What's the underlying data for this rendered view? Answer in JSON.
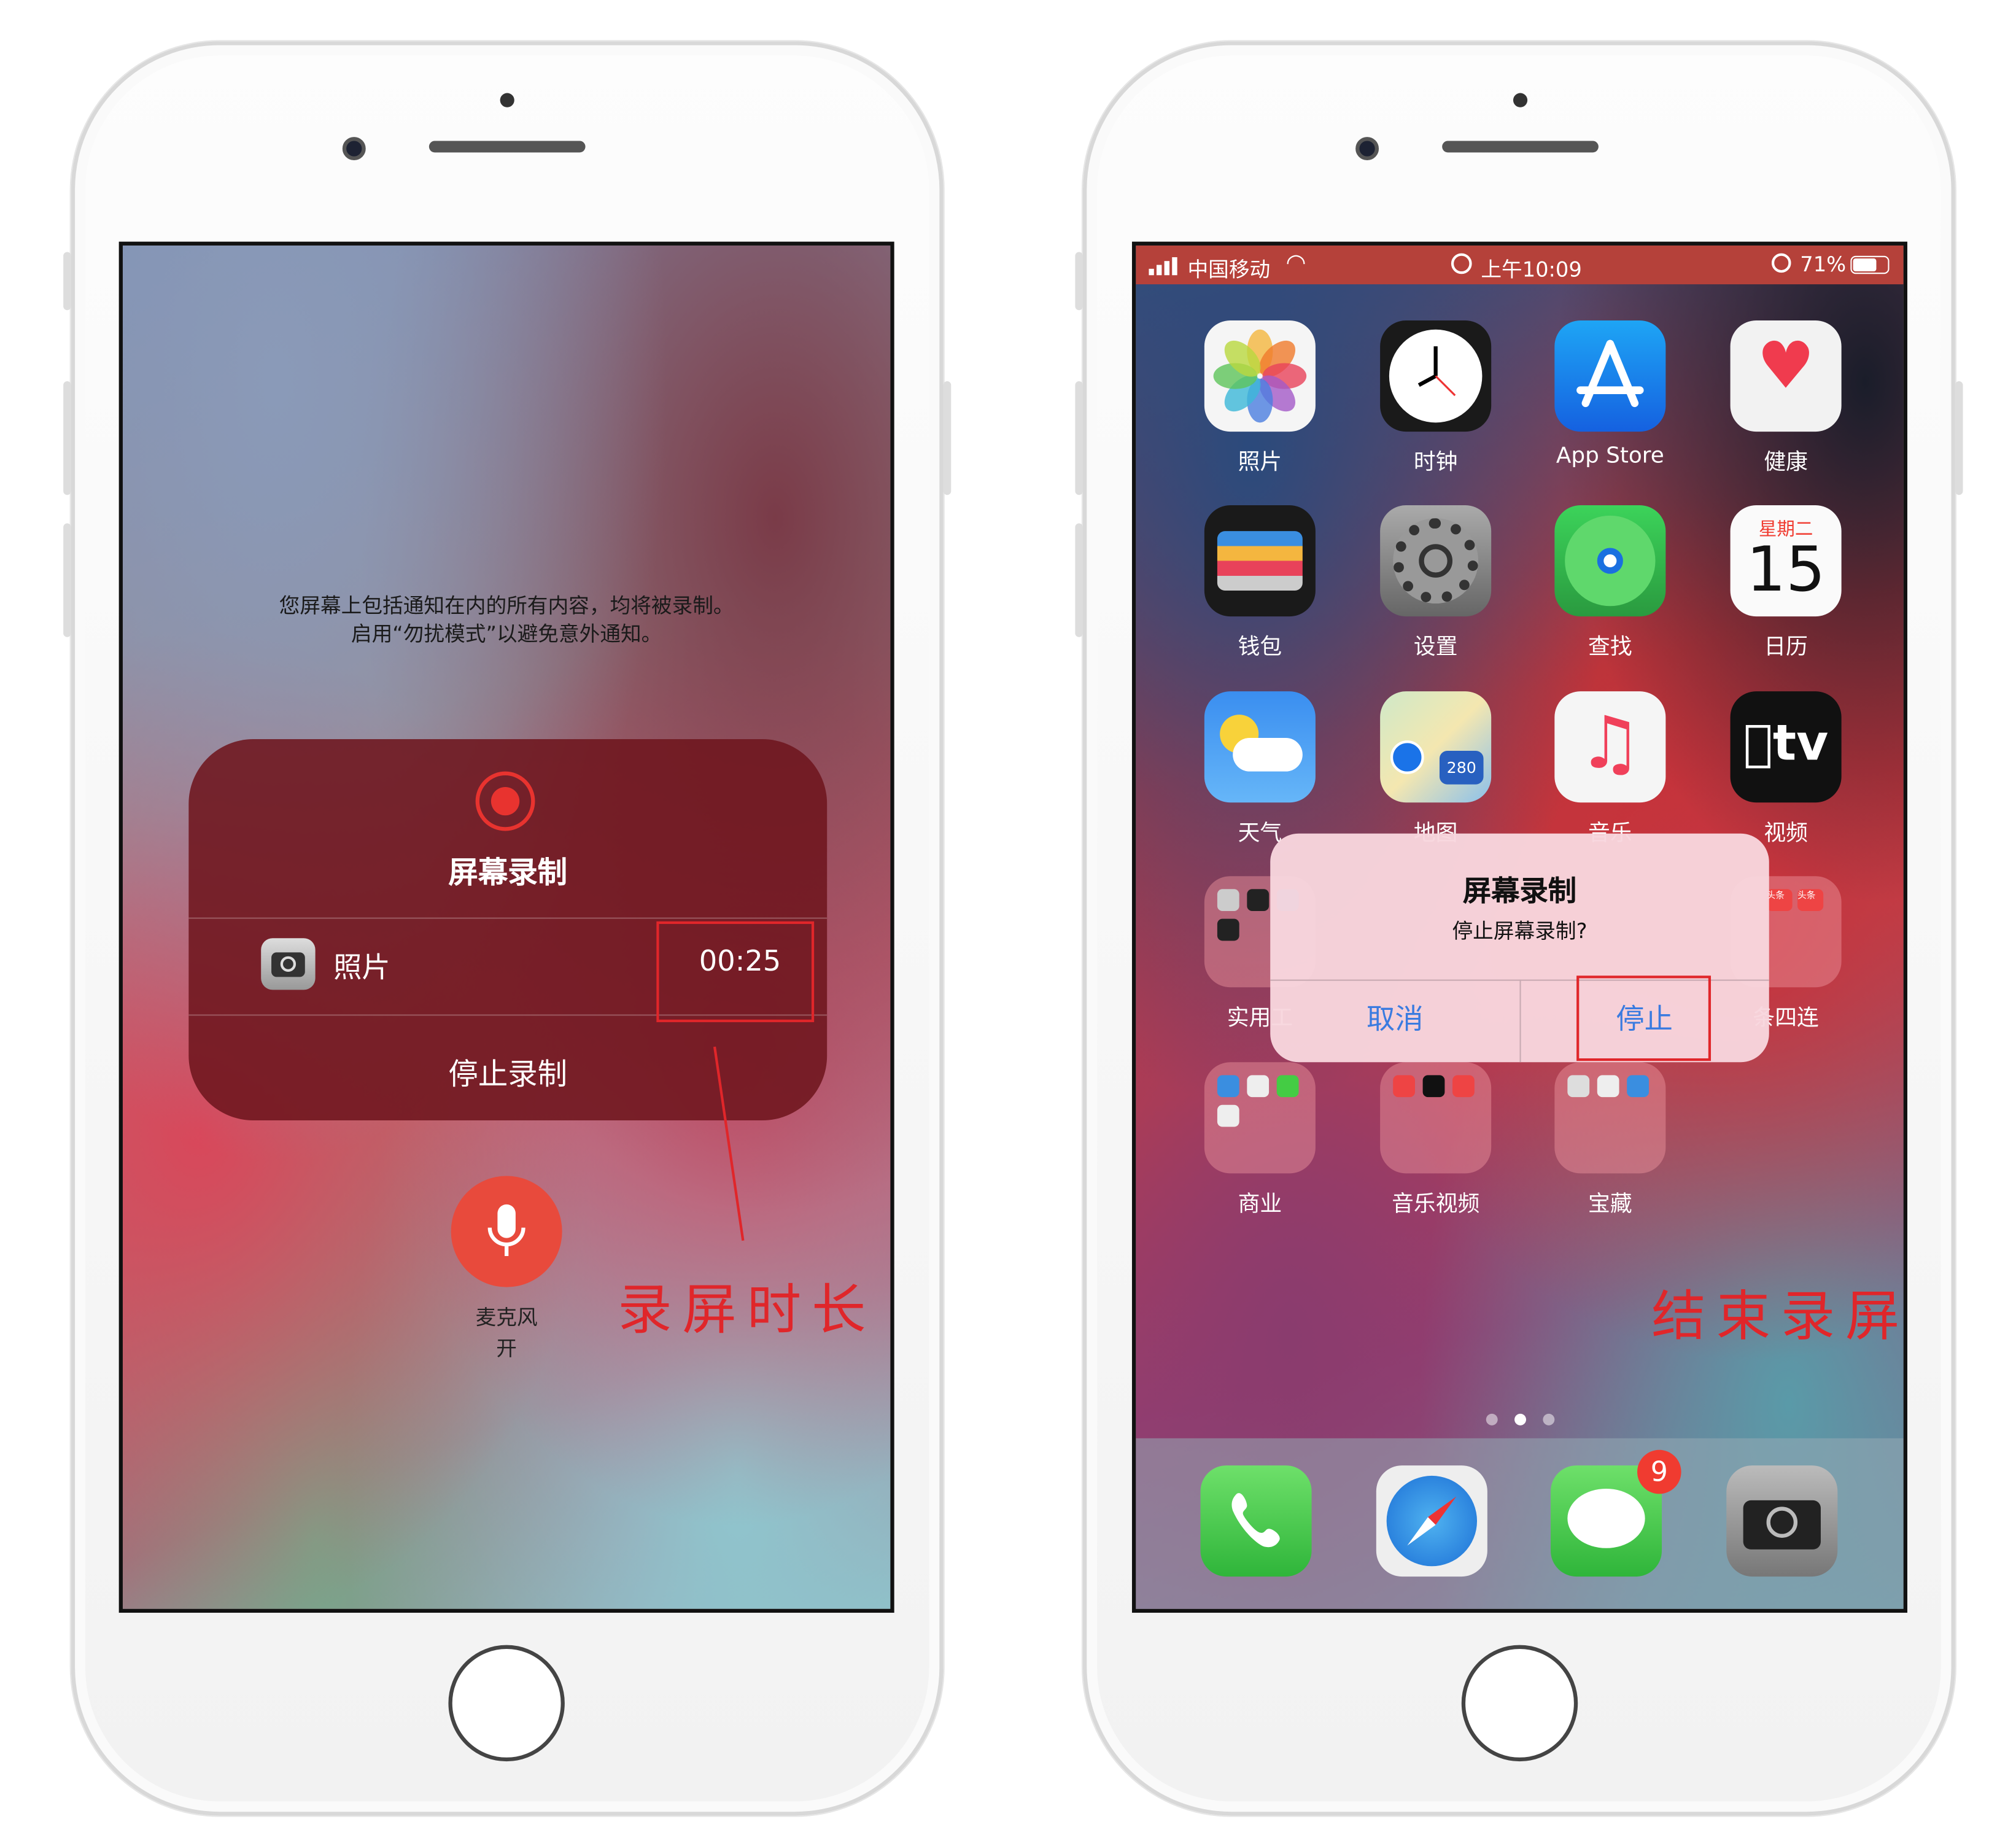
{
  "left_phone": {
    "warning_line1": "您屏幕上包括通知在内的所有内容，均将被录制。",
    "warning_line2": "启用“勿扰模式”以避免意外通知。",
    "panel": {
      "title": "屏幕录制",
      "app_label": "照片",
      "duration": "00:25",
      "stop_label": "停止录制"
    },
    "mic": {
      "label": "麦克风",
      "state": "开"
    },
    "annotation": "录屏时长"
  },
  "right_phone": {
    "status": {
      "carrier": "中国移动",
      "time": "上午10:09",
      "battery": "71%",
      "bar_color": "#b5413a"
    },
    "apps": [
      {
        "label": "照片",
        "icon": "photos-icon"
      },
      {
        "label": "时钟",
        "icon": "clock-icon"
      },
      {
        "label": "App Store",
        "icon": "app-store-icon"
      },
      {
        "label": "健康",
        "icon": "health-icon"
      },
      {
        "label": "钱包",
        "icon": "wallet-icon"
      },
      {
        "label": "设置",
        "icon": "settings-icon"
      },
      {
        "label": "查找",
        "icon": "find-my-icon"
      },
      {
        "label": "日历",
        "icon": "calendar-icon"
      },
      {
        "label": "天气",
        "icon": "weather-icon"
      },
      {
        "label": "地图",
        "icon": "maps-icon"
      },
      {
        "label": "音乐",
        "icon": "music-icon"
      },
      {
        "label": "视频",
        "icon": "apple-tv-icon"
      }
    ],
    "calendar": {
      "weekday": "星期二",
      "day": "15"
    },
    "tv_text": "tv",
    "maps_badge": "280",
    "folders": [
      {
        "label": "实用工"
      },
      {
        "label": "条四连"
      },
      {
        "label": "商业"
      },
      {
        "label": "音乐视频"
      },
      {
        "label": "宝藏"
      }
    ],
    "toutiao": "头条",
    "dialog": {
      "title": "屏幕录制",
      "message": "停止屏幕录制?",
      "cancel": "取消",
      "stop": "停止",
      "button_color": "#3a7be0"
    },
    "dock": [
      {
        "icon": "phone-icon"
      },
      {
        "icon": "safari-icon"
      },
      {
        "icon": "messages-icon",
        "badge": "9"
      },
      {
        "icon": "camera-icon"
      }
    ],
    "page_indicator": {
      "pages": 3,
      "current": 2
    },
    "annotation": "结束录屏"
  },
  "accent": "#e0262a"
}
